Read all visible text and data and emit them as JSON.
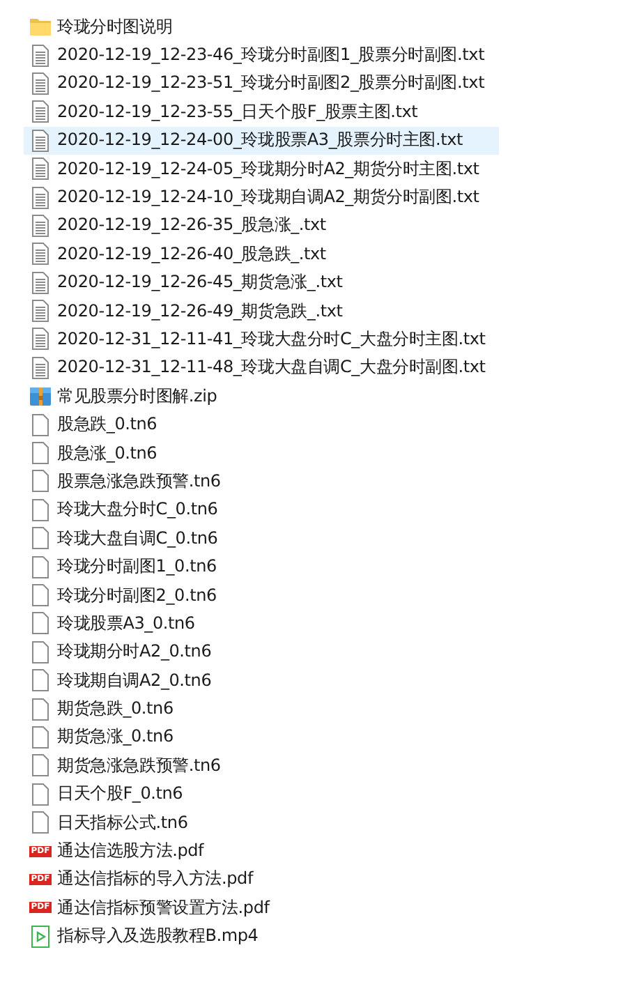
{
  "files": [
    {
      "name": "玲珑分时图说明",
      "kind": "folder",
      "selected": false
    },
    {
      "name": "2020-12-19_12-23-46_玲珑分时副图1_股票分时副图.txt",
      "kind": "text",
      "selected": false
    },
    {
      "name": "2020-12-19_12-23-51_玲珑分时副图2_股票分时副图.txt",
      "kind": "text",
      "selected": false
    },
    {
      "name": "2020-12-19_12-23-55_日天个股F_股票主图.txt",
      "kind": "text",
      "selected": false
    },
    {
      "name": "2020-12-19_12-24-00_玲珑股票A3_股票分时主图.txt",
      "kind": "text",
      "selected": true
    },
    {
      "name": "2020-12-19_12-24-05_玲珑期分时A2_期货分时主图.txt",
      "kind": "text",
      "selected": false
    },
    {
      "name": "2020-12-19_12-24-10_玲珑期自调A2_期货分时副图.txt",
      "kind": "text",
      "selected": false
    },
    {
      "name": "2020-12-19_12-26-35_股急涨_.txt",
      "kind": "text",
      "selected": false
    },
    {
      "name": "2020-12-19_12-26-40_股急跌_.txt",
      "kind": "text",
      "selected": false
    },
    {
      "name": "2020-12-19_12-26-45_期货急涨_.txt",
      "kind": "text",
      "selected": false
    },
    {
      "name": "2020-12-19_12-26-49_期货急跌_.txt",
      "kind": "text",
      "selected": false
    },
    {
      "name": "2020-12-31_12-11-41_玲珑大盘分时C_大盘分时主图.txt",
      "kind": "text",
      "selected": false
    },
    {
      "name": "2020-12-31_12-11-48_玲珑大盘自调C_大盘分时副图.txt",
      "kind": "text",
      "selected": false
    },
    {
      "name": "常见股票分时图解.zip",
      "kind": "archive",
      "selected": false
    },
    {
      "name": "股急跌_0.tn6",
      "kind": "blank",
      "selected": false
    },
    {
      "name": "股急涨_0.tn6",
      "kind": "blank",
      "selected": false
    },
    {
      "name": "股票急涨急跌预警.tn6",
      "kind": "blank",
      "selected": false
    },
    {
      "name": "玲珑大盘分时C_0.tn6",
      "kind": "blank",
      "selected": false
    },
    {
      "name": "玲珑大盘自调C_0.tn6",
      "kind": "blank",
      "selected": false
    },
    {
      "name": "玲珑分时副图1_0.tn6",
      "kind": "blank",
      "selected": false
    },
    {
      "name": "玲珑分时副图2_0.tn6",
      "kind": "blank",
      "selected": false
    },
    {
      "name": "玲珑股票A3_0.tn6",
      "kind": "blank",
      "selected": false
    },
    {
      "name": "玲珑期分时A2_0.tn6",
      "kind": "blank",
      "selected": false
    },
    {
      "name": "玲珑期自调A2_0.tn6",
      "kind": "blank",
      "selected": false
    },
    {
      "name": "期货急跌_0.tn6",
      "kind": "blank",
      "selected": false
    },
    {
      "name": "期货急涨_0.tn6",
      "kind": "blank",
      "selected": false
    },
    {
      "name": "期货急涨急跌预警.tn6",
      "kind": "blank",
      "selected": false
    },
    {
      "name": "日天个股F_0.tn6",
      "kind": "blank",
      "selected": false
    },
    {
      "name": "日天指标公式.tn6",
      "kind": "blank",
      "selected": false
    },
    {
      "name": "通达信选股方法.pdf",
      "kind": "pdf",
      "icon_label": "PDF",
      "selected": false
    },
    {
      "name": "通达信指标的导入方法.pdf",
      "kind": "pdf",
      "icon_label": "PDF",
      "selected": false
    },
    {
      "name": "通达信指标预警设置方法.pdf",
      "kind": "pdf",
      "icon_label": "PDF",
      "selected": false
    },
    {
      "name": "指标导入及选股教程B.mp4",
      "kind": "video",
      "selected": false
    }
  ]
}
